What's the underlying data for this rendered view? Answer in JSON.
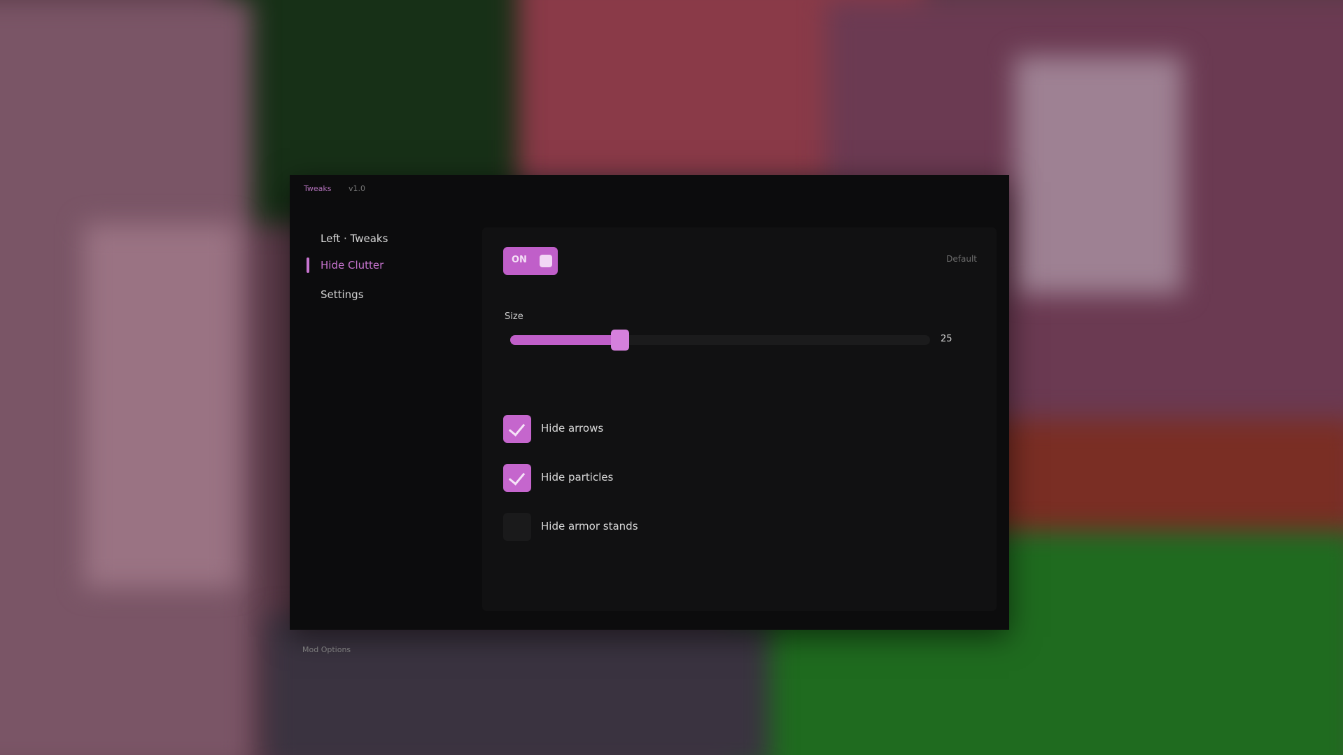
{
  "window": {
    "app_name": "Tweaks",
    "version": "v1.0"
  },
  "sidebar": {
    "group_title": "Left · Tweaks",
    "items": [
      {
        "label": "Hide Clutter",
        "active": true
      },
      {
        "label": "Settings",
        "active": false
      }
    ],
    "footer": "Mod Options"
  },
  "panel": {
    "toggle_label": "ON",
    "hint": "Default",
    "slider": {
      "label": "Size",
      "value": 0.25,
      "value_text": "25"
    },
    "checkboxes": [
      {
        "label": "Hide arrows",
        "checked": true
      },
      {
        "label": "Hide particles",
        "checked": true
      },
      {
        "label": "Hide armor stands",
        "checked": false
      }
    ]
  },
  "colors": {
    "accent": "#c05fc9",
    "window_bg": "#0c0c0d",
    "panel_bg": "#111112"
  }
}
